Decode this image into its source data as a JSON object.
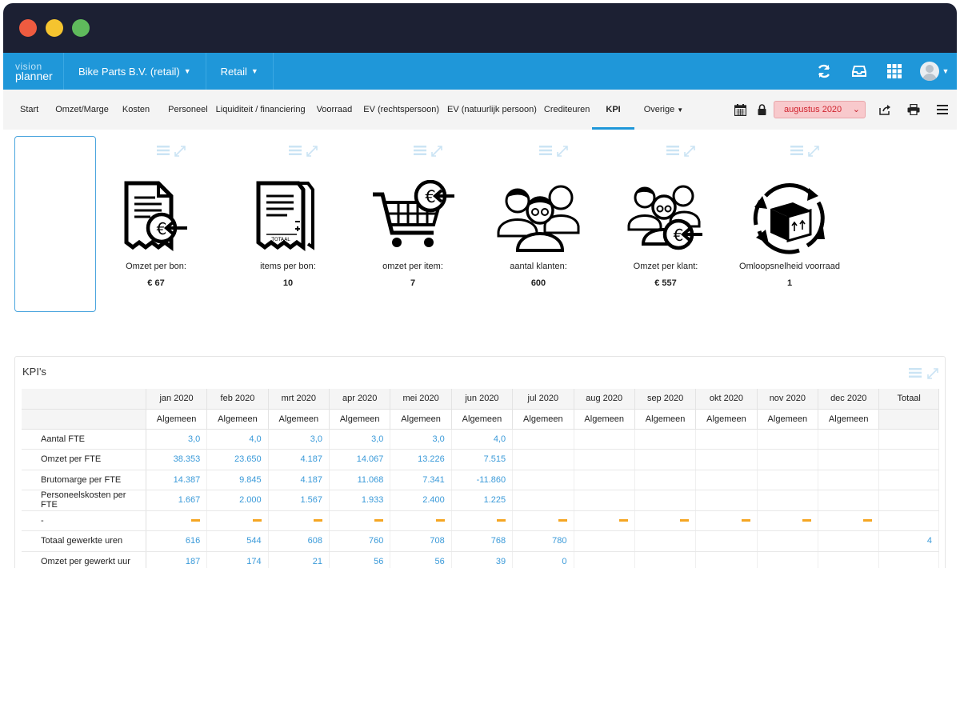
{
  "app": {
    "logo_line1": "vision",
    "logo_line2": "planner",
    "company": "Bike Parts B.V. (retail)",
    "segment": "Retail"
  },
  "icons": {
    "refresh": "refresh-icon",
    "inbox": "inbox-icon",
    "apps": "apps-grid-icon",
    "user": "user-avatar-icon"
  },
  "colors": {
    "titlebar": "#1c2033",
    "topnav": "#1f97d9",
    "accent": "#1f97d9",
    "value_text": "#3a9ad9",
    "month_bg": "#f8c9cc",
    "month_text": "#d0242f",
    "dash": "#f5a623"
  },
  "tabs": [
    {
      "label": "Start"
    },
    {
      "label": "Omzet/Marge"
    },
    {
      "label": "Kosten"
    },
    {
      "label": "Personeel"
    },
    {
      "label": "Liquiditeit / financiering"
    },
    {
      "label": "Voorraad"
    },
    {
      "label": "EV (rechtspersoon)"
    },
    {
      "label": "EV (natuurlijk persoon)"
    },
    {
      "label": "Crediteuren"
    },
    {
      "label": "KPI"
    },
    {
      "label": "Overige"
    }
  ],
  "period": {
    "selected": "augustus 2020"
  },
  "kpi_cards": [
    {
      "label": "Omzet per bon:",
      "value": "€ 67",
      "icon": "receipt-euro-icon"
    },
    {
      "label": "items per bon:",
      "value": "10",
      "icon": "receipt-total-icon"
    },
    {
      "label": "omzet per item:",
      "value": "7",
      "icon": "cart-euro-icon"
    },
    {
      "label": "aantal klanten:",
      "value": "600",
      "icon": "customers-icon"
    },
    {
      "label": "Omzet per klant:",
      "value": "€ 557",
      "icon": "customers-euro-icon"
    },
    {
      "label": "Omloopsnelheid voorraad",
      "value": "1",
      "icon": "stock-turnover-icon"
    }
  ],
  "kpi_table": {
    "title": "KPI's",
    "subheader": "Algemeen",
    "months": [
      "jan 2020",
      "feb 2020",
      "mrt 2020",
      "apr 2020",
      "mei 2020",
      "jun 2020",
      "jul 2020",
      "aug 2020",
      "sep 2020",
      "okt 2020",
      "nov 2020",
      "dec 2020",
      "Totaal"
    ],
    "rows": [
      {
        "label": "Aantal FTE",
        "values": [
          "3,0",
          "4,0",
          "3,0",
          "3,0",
          "3,0",
          "4,0",
          "",
          "",
          "",
          "",
          "",
          "",
          ""
        ]
      },
      {
        "label": "Omzet per FTE",
        "values": [
          "38.353",
          "23.650",
          "4.187",
          "14.067",
          "13.226",
          "7.515",
          "",
          "",
          "",
          "",
          "",
          "",
          ""
        ]
      },
      {
        "label": "Brutomarge per FTE",
        "values": [
          "14.387",
          "9.845",
          "4.187",
          "11.068",
          "7.341",
          "-11.860",
          "",
          "",
          "",
          "",
          "",
          "",
          ""
        ]
      },
      {
        "label": "Personeelskosten per FTE",
        "values": [
          "1.667",
          "2.000",
          "1.567",
          "1.933",
          "2.400",
          "1.225",
          "",
          "",
          "",
          "",
          "",
          "",
          ""
        ]
      },
      {
        "label": "-",
        "dash": true,
        "values": [
          "",
          "",
          "",
          "",
          "",
          "",
          "",
          "",
          "",
          "",
          "",
          "",
          ""
        ]
      },
      {
        "label": "Totaal gewerkte uren",
        "values": [
          "616",
          "544",
          "608",
          "760",
          "708",
          "768",
          "780",
          "",
          "",
          "",
          "",
          "",
          "4"
        ]
      },
      {
        "label": "Omzet per gewerkt uur",
        "values": [
          "187",
          "174",
          "21",
          "56",
          "56",
          "39",
          "0",
          "",
          "",
          "",
          "",
          "",
          ""
        ]
      }
    ]
  }
}
